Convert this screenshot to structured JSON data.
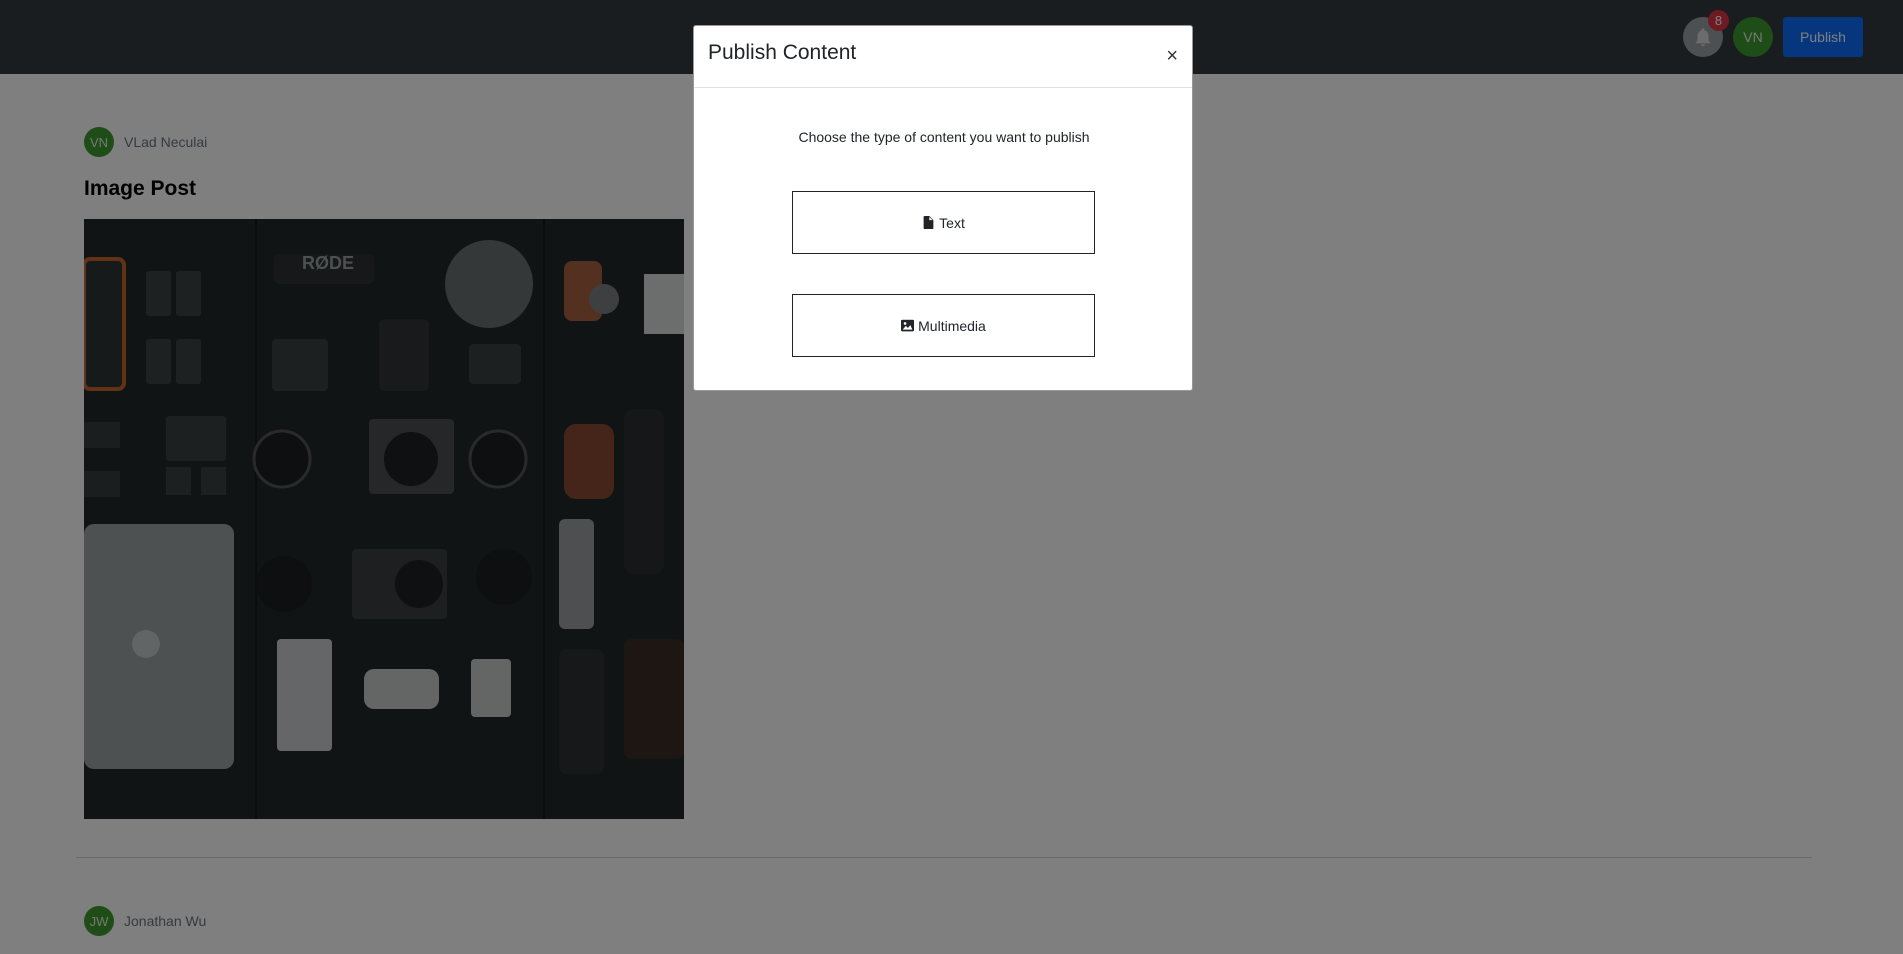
{
  "navbar": {
    "notification_count": "8",
    "user_initials": "VN",
    "publish_label": "Publish"
  },
  "feed": {
    "posts": [
      {
        "author_initials": "VN",
        "author_name": "VLad Neculai",
        "title": "Image Post"
      },
      {
        "author_initials": "JW",
        "author_name": "Jonathan Wu"
      }
    ]
  },
  "modal": {
    "title": "Publish Content",
    "close_label": "×",
    "prompt": "Choose the type of content you want to publish",
    "options": [
      {
        "label": "Text",
        "icon": "file-text-icon"
      },
      {
        "label": "Multimedia",
        "icon": "image-icon"
      }
    ]
  },
  "colors": {
    "navbar_bg": "#343a40",
    "accent": "#0d6efd",
    "avatar_green": "#3f9a2f",
    "badge_red": "#dc3545"
  }
}
